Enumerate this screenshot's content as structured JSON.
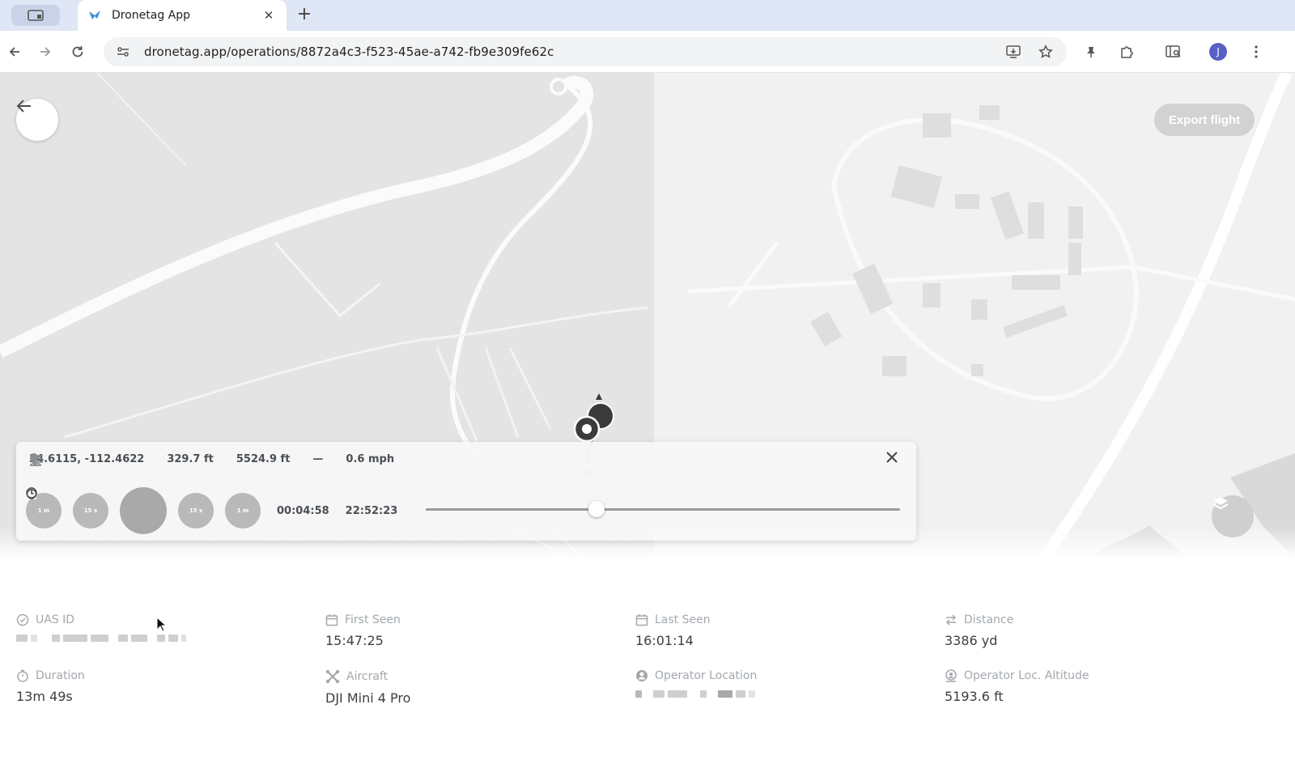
{
  "browser": {
    "tab_title": "Dronetag App",
    "url": "dronetag.app/operations/8872a4c3-f523-45ae-a742-fb9e309fe62c",
    "profile_initial": "J"
  },
  "map": {
    "export_label": "Export flight"
  },
  "player": {
    "coords": "34.6115, -112.4622",
    "height": "329.7 ft",
    "altitude": "5524.9 ft",
    "vertical": "—",
    "speed": "0.6 mph",
    "btn_back_1m": "1 m",
    "btn_back_15s": "15 s",
    "btn_fwd_15s": "15 s",
    "btn_fwd_1m": "1 m",
    "elapsed": "00:04:58",
    "clock": "22:52:23",
    "progress": 0.36
  },
  "details": {
    "uas_id": {
      "label": "UAS ID"
    },
    "first_seen": {
      "label": "First Seen",
      "value": "15:47:25"
    },
    "last_seen": {
      "label": "Last Seen",
      "value": "16:01:14"
    },
    "distance": {
      "label": "Distance",
      "value": "3386 yd"
    },
    "duration": {
      "label": "Duration",
      "value": "13m 49s"
    },
    "aircraft": {
      "label": "Aircraft",
      "value": "DJI Mini 4 Pro"
    },
    "operator_location": {
      "label": "Operator Location"
    },
    "operator_altitude": {
      "label": "Operator Loc. Altitude",
      "value": "5193.6 ft"
    }
  },
  "colors": {
    "map_left": "#e4e4e4",
    "map_right": "#f1f1f1",
    "control_grey": "#b9b9b9",
    "avatar": "#5860c4"
  }
}
